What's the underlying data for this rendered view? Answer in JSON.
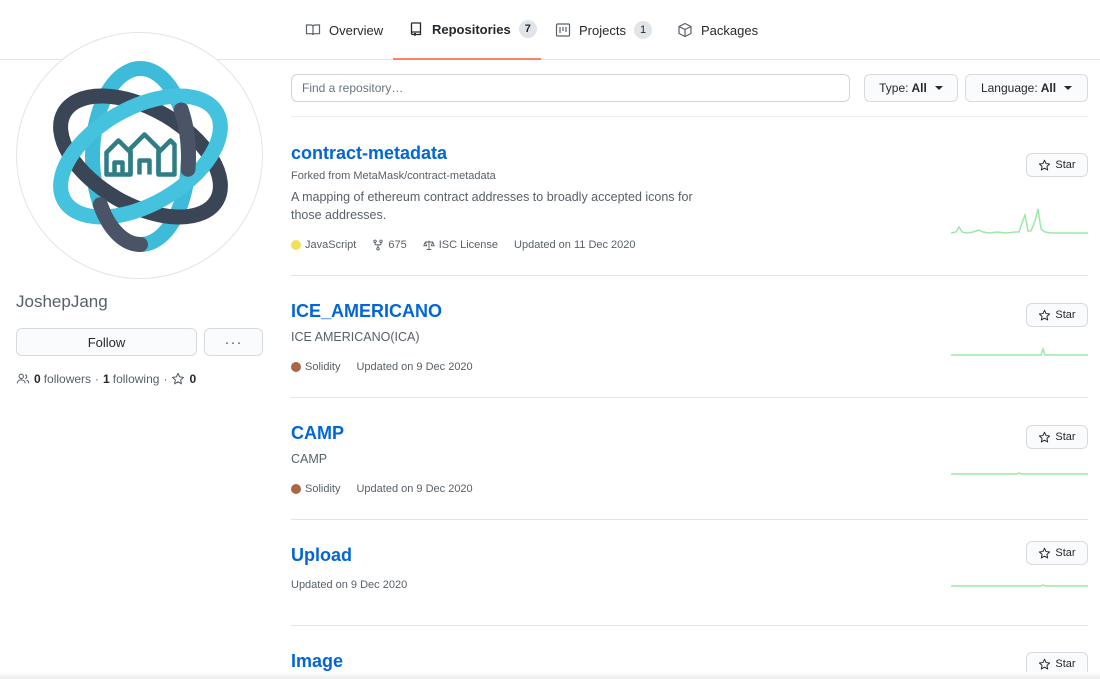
{
  "nav": {
    "tabs": [
      {
        "label": "Overview",
        "icon": "book-icon",
        "count": null
      },
      {
        "label": "Repositories",
        "icon": "repo-icon",
        "count": "7"
      },
      {
        "label": "Projects",
        "icon": "project-icon",
        "count": "1"
      },
      {
        "label": "Packages",
        "icon": "package-icon",
        "count": null
      }
    ],
    "selected_tab": "Repositories",
    "selected_underline_color": "#f9826c"
  },
  "profile": {
    "username": "JoshepJang",
    "follow_label": "Follow",
    "more_label": "···",
    "followers_count": "0",
    "followers_label": "followers",
    "following_count": "1",
    "following_label": "following",
    "stars_count": "0"
  },
  "filters": {
    "search_placeholder": "Find a repository…",
    "type_label": "Type:",
    "type_value": "All",
    "language_label": "Language:",
    "language_value": "All"
  },
  "repos": [
    {
      "name": "contract-metadata",
      "fork_note": "Forked from MetaMask/contract-metadata",
      "description": "A mapping of ethereum contract addresses to broadly accepted icons for those addresses.",
      "language": "JavaScript",
      "language_color": "#f1e05a",
      "forks": "675",
      "license": "ISC License",
      "updated": "Updated on 11 Dec 2020",
      "star_label": "Star"
    },
    {
      "name": "ICE_AMERICANO",
      "description": "ICE AMERICANO(ICA)",
      "language": "Solidity",
      "language_color": "#aa6746",
      "updated": "Updated on 9 Dec 2020",
      "star_label": "Star"
    },
    {
      "name": "CAMP",
      "description": "CAMP",
      "language": "Solidity",
      "language_color": "#aa6746",
      "updated": "Updated on 9 Dec 2020",
      "star_label": "Star"
    },
    {
      "name": "Upload",
      "updated": "Updated on 9 Dec 2020",
      "star_label": "Star"
    },
    {
      "name": "Image",
      "star_label": "Star"
    }
  ],
  "colors": {
    "link": "#0366d6",
    "sparkline": "#9be9a8",
    "muted_text": "#586069"
  }
}
